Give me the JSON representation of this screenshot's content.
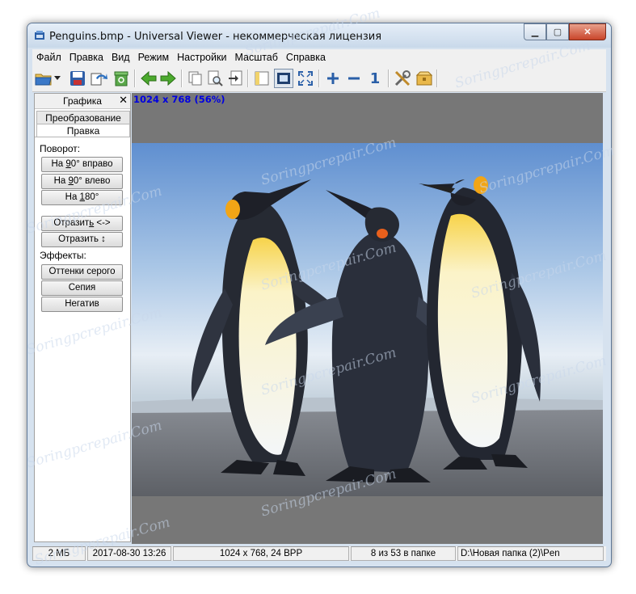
{
  "window": {
    "title": "Penguins.bmp - Universal Viewer - некоммерческая лицензия",
    "buttons": [
      "minimize",
      "maximize",
      "close"
    ]
  },
  "menu": [
    "Файл",
    "Правка",
    "Вид",
    "Режим",
    "Настройки",
    "Масштаб",
    "Справка"
  ],
  "toolbar": {
    "icons": [
      "open-folder-icon",
      "dropdown-arrow-icon",
      "save-icon",
      "refresh-icon",
      "recycle-icon",
      "back-arrow-icon",
      "forward-arrow-icon",
      "copy-icon",
      "preview-icon",
      "export-icon",
      "panel-icon",
      "fit-window-icon",
      "fullscreen-icon",
      "zoom-in-icon",
      "zoom-out-icon",
      "actual-size-icon",
      "tools-icon",
      "package-icon"
    ],
    "actual_size_label": "1"
  },
  "panel": {
    "title": "Графика",
    "close": "✕",
    "tabs": [
      "Преобразование",
      "Правка"
    ],
    "rotation_label": "Поворот:",
    "rotation_buttons": [
      {
        "pre": "На ",
        "u": "9",
        "post": "0° вправо"
      },
      {
        "pre": "На ",
        "u": "9",
        "post": "0° влево"
      },
      {
        "pre": "На ",
        "u": "1",
        "post": "80°"
      }
    ],
    "flip_buttons": [
      {
        "pre": "Отразит",
        "u": "ь",
        "post": " <->"
      },
      {
        "pre": "Отразить ",
        "u": "",
        "post": "↕"
      }
    ],
    "effects_label": "Эффекты:",
    "effects_buttons": [
      "Оттенки серого",
      "Сепия",
      "Негатив"
    ]
  },
  "viewer": {
    "image_info": "1024 x 768 (56%)",
    "background": "#777777"
  },
  "status": {
    "size": "2 МБ",
    "date": "2017-08-30 13:26",
    "dimensions": "1024 x 768, 24 BPP",
    "position": "8 из 53 в папке",
    "path": "D:\\Новая папка (2)\\Pen"
  },
  "watermark": "Soringpcrepair.Com"
}
